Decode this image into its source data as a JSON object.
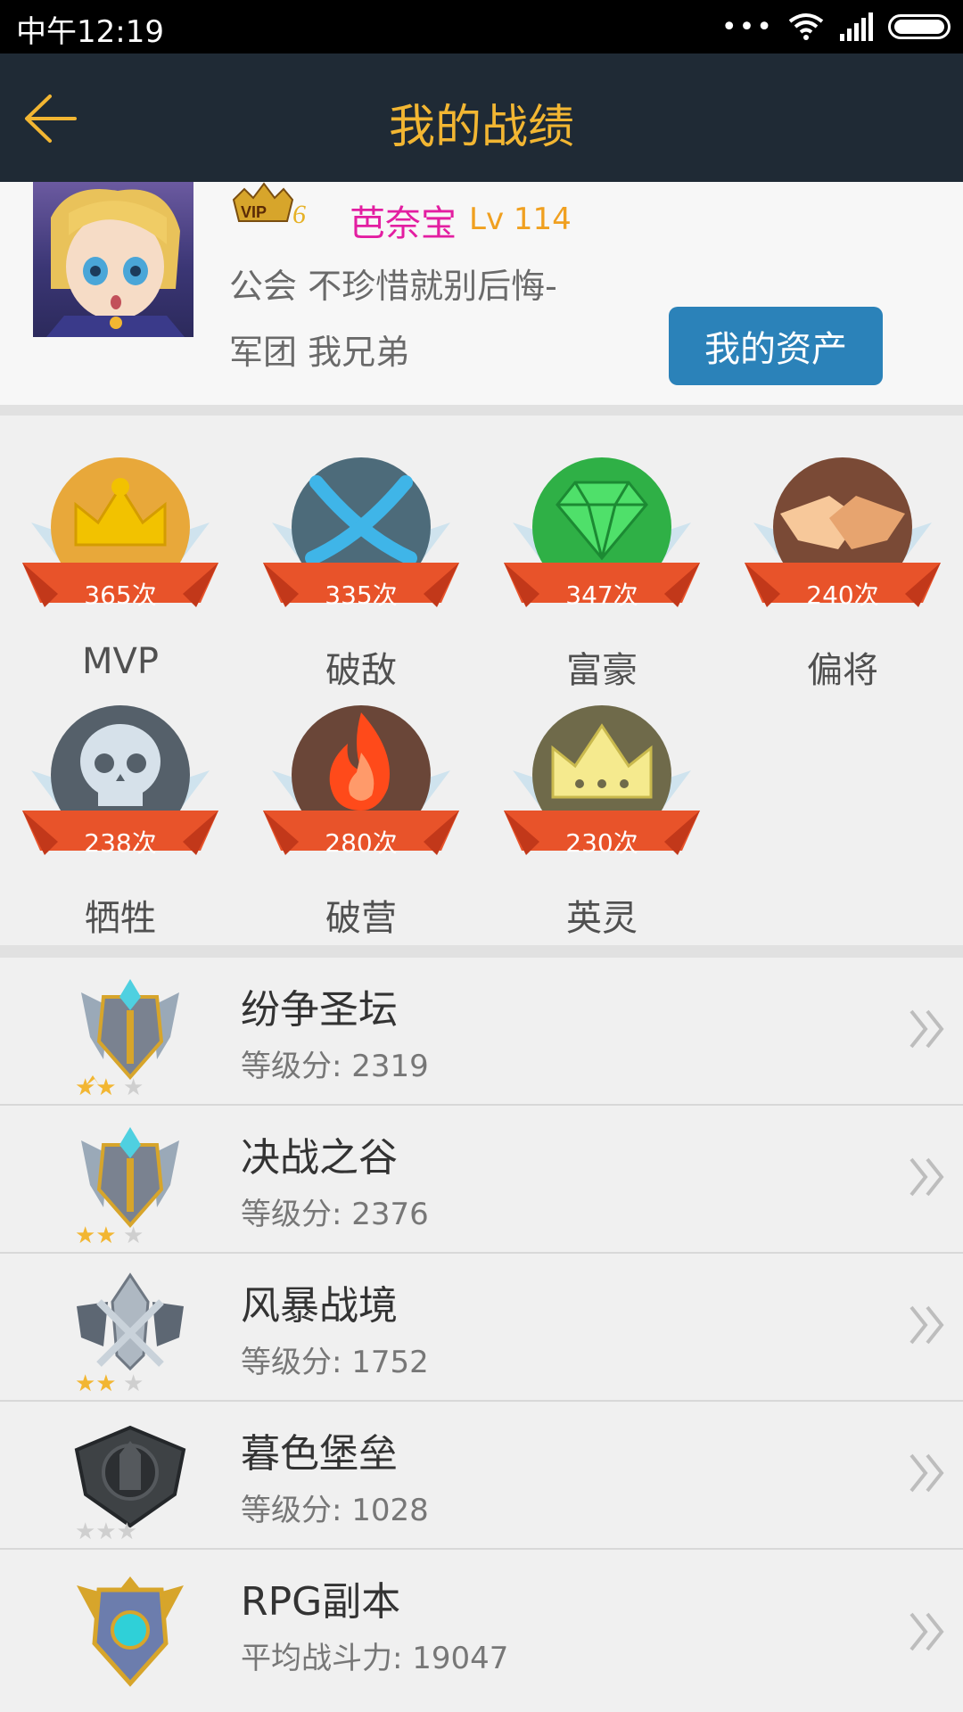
{
  "status_bar": {
    "time": "中午12:19",
    "dots": "•••"
  },
  "header": {
    "title": "我的战绩"
  },
  "profile": {
    "name": "芭奈宝",
    "level": "Lv 114",
    "guild": "公会  不珍惜就别后悔-",
    "legion": "军团  我兄弟",
    "assets_button": "我的资产",
    "vip_level": "6"
  },
  "badges": [
    {
      "label": "MVP",
      "count": "365次",
      "color": "#f2c200"
    },
    {
      "label": "破敌",
      "count": "335次",
      "color": "#3aa6d9"
    },
    {
      "label": "富豪",
      "count": "347次",
      "color": "#32c24a"
    },
    {
      "label": "偏将",
      "count": "240次",
      "color": "#d89a70"
    },
    {
      "label": "牺牲",
      "count": "238次",
      "color": "#b7c2cc"
    },
    {
      "label": "破营",
      "count": "280次",
      "color": "#ff5a2a"
    },
    {
      "label": "英灵",
      "count": "230次",
      "color": "#f0e58a"
    }
  ],
  "modes": [
    {
      "title": "纷争圣坛",
      "score": "等级分: 2319"
    },
    {
      "title": "决战之谷",
      "score": "等级分: 2376"
    },
    {
      "title": "风暴战境",
      "score": "等级分: 1752"
    },
    {
      "title": "暮色堡垒",
      "score": "等级分: 1028"
    },
    {
      "title": "RPG副本",
      "score": "平均战斗力: 19047"
    }
  ]
}
